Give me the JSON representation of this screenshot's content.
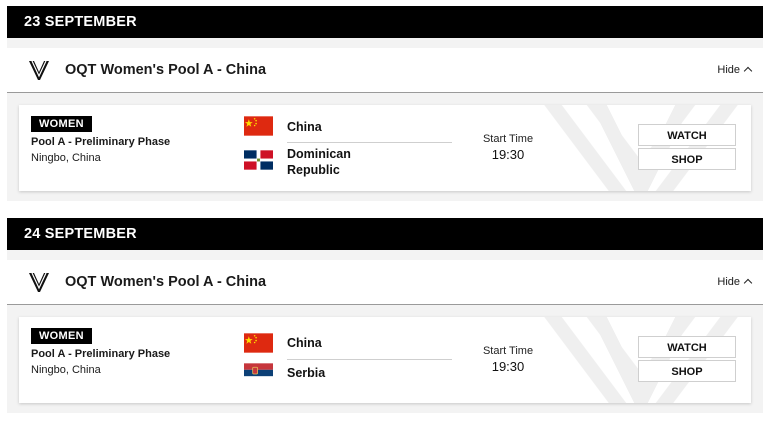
{
  "days": [
    {
      "date": "23 SEPTEMBER",
      "tournament": "OQT Women's Pool A - China",
      "hide_label": "Hide",
      "match": {
        "category": "WOMEN",
        "phase": "Pool A - Preliminary Phase",
        "venue": "Ningbo, China",
        "team1": "China",
        "team2_line1": "Dominican",
        "team2_line2": "Republic",
        "start_label": "Start Time",
        "start_time": "19:30",
        "watch": "WATCH",
        "shop": "SHOP"
      }
    },
    {
      "date": "24 SEPTEMBER",
      "tournament": "OQT Women's Pool A - China",
      "hide_label": "Hide",
      "match": {
        "category": "WOMEN",
        "phase": "Pool A - Preliminary Phase",
        "venue": "Ningbo, China",
        "team1": "China",
        "team2": "Serbia",
        "start_label": "Start Time",
        "start_time": "19:30",
        "watch": "WATCH",
        "shop": "SHOP"
      }
    }
  ],
  "icons": {
    "logo": "volleyball-league-logo-icon",
    "hide": "chevron-up-icon",
    "flag1": "china-flag-icon",
    "flag2a": "dominican-republic-flag-icon",
    "flag2b": "serbia-flag-icon"
  }
}
